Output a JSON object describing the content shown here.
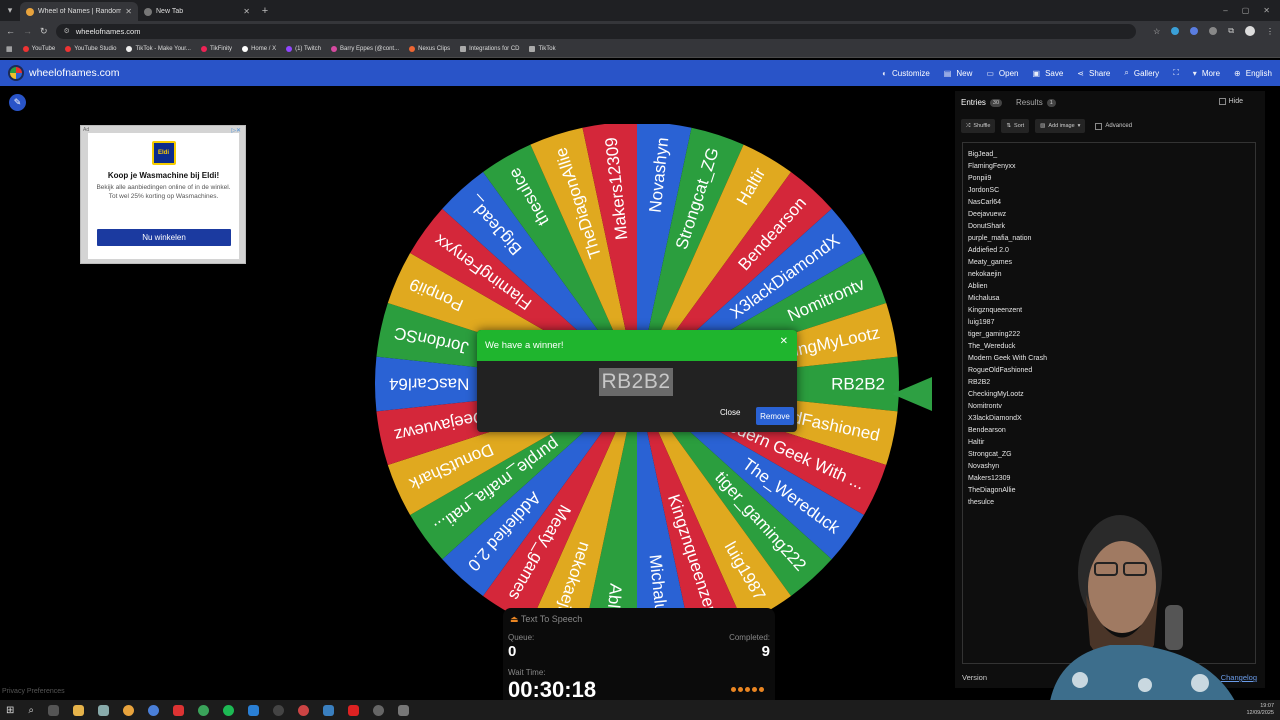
{
  "browser": {
    "tabs": [
      {
        "label": "Wheel of Names | Random nam",
        "active": true
      },
      {
        "label": "New Tab",
        "active": false
      }
    ],
    "url": "wheelofnames.com",
    "bookmarks": [
      "YouTube",
      "YouTube Studio",
      "TikTok - Make Your...",
      "TikFinity",
      "Home / X",
      "(1) Twitch",
      "Barry Eppes (@cont...",
      "Nexus Clips",
      "Integrations for CD",
      "TikTok"
    ]
  },
  "site": {
    "logo": "wheelofnames.com",
    "nav": [
      {
        "label": "Customize",
        "icon": "palette-icon",
        "glyph": "◐"
      },
      {
        "label": "New",
        "icon": "file-icon",
        "glyph": "▤"
      },
      {
        "label": "Open",
        "icon": "folder-icon",
        "glyph": "▭"
      },
      {
        "label": "Save",
        "icon": "save-icon",
        "glyph": "▣"
      },
      {
        "label": "Share",
        "icon": "share-icon",
        "glyph": "⋖"
      },
      {
        "label": "Gallery",
        "icon": "search-icon",
        "glyph": "⌕"
      },
      {
        "label": "",
        "icon": "fullscreen-icon",
        "glyph": "⛶"
      },
      {
        "label": "More",
        "icon": "chevron-down-icon",
        "glyph": "▾"
      },
      {
        "label": "English",
        "icon": "globe-icon",
        "glyph": "⊕"
      }
    ]
  },
  "ad": {
    "badge": "Ad",
    "logo_text": "Eldi",
    "title": "Koop je Wasmachine bij Eldi!",
    "text": "Bekijk alle aanbiedingen online of in de winkel. Tot wel 25% korting op Wasmachines.",
    "button": "Nu winkelen"
  },
  "privacy_link": "Privacy Preferences",
  "wheel": {
    "colors": [
      "#2b9e3e",
      "#e0a91f",
      "#d4273a",
      "#2a62d4"
    ],
    "labels": [
      "RB2B2",
      "RogueOldFashioned",
      "Modern Geek With ...",
      "The_Wereduck",
      "tiger_gaming222",
      "luig1987",
      "Kingznqueenzent",
      "Michalusa",
      "Ablien",
      "nekokaejin",
      "Meaty_games",
      "Addiefied 2.0",
      "purple_mafia_nati...",
      "DonutShark",
      "Deejavuewz",
      "NasCarl64",
      "JordonSC",
      "Ponpii9",
      "FlamingFenyxx",
      "BigJead_",
      "thesulce",
      "TheDiagonAllie",
      "Makers12309",
      "Novashyn",
      "Strongcat_ZG",
      "Haltir",
      "Bendearson",
      "X3lackDiamondX",
      "Nomitrontv",
      "CheckingMyLootz"
    ]
  },
  "modal": {
    "title": "We have a winner!",
    "winner": "RB2B2",
    "close_label": "Close",
    "remove_label": "Remove"
  },
  "tts": {
    "title": "Text To Speech",
    "queue_label": "Queue:",
    "queue": "0",
    "completed_label": "Completed:",
    "completed": "9",
    "wait_label": "Wait Time:",
    "wait": "00:30:18"
  },
  "panel": {
    "entries_tab": "Entries",
    "entries_count": "30",
    "results_tab": "Results",
    "results_count": "1",
    "hide": "Hide",
    "shuffle": "Shuffle",
    "sort": "Sort",
    "add_image": "Add image",
    "advanced": "Advanced",
    "entries": [
      "BigJead_",
      "FlamingFenyxx",
      "Ponpii9",
      "JordonSC",
      "NasCarl64",
      "Deejavuewz",
      "DonutShark",
      "purple_mafia_nation",
      "Addiefied 2.0",
      "Meaty_games",
      "nekokaejin",
      "Ablien",
      "Michalusa",
      "Kingznqueenzent",
      "luig1987",
      "tiger_gaming222",
      "The_Wereduck",
      "Modern Geek With Crash",
      "RogueOldFashioned",
      "RB2B2",
      "CheckingMyLootz",
      "Nomitrontv",
      "X3lackDiamondX",
      "Bendearson",
      "Haltir",
      "Strongcat_ZG",
      "Novashyn",
      "Makers12309",
      "TheDiagonAllie",
      "thesulce"
    ],
    "version": "Version",
    "changelog": "Changelog"
  },
  "taskbar": {
    "time": "19:07",
    "date": "12/09/2025"
  }
}
